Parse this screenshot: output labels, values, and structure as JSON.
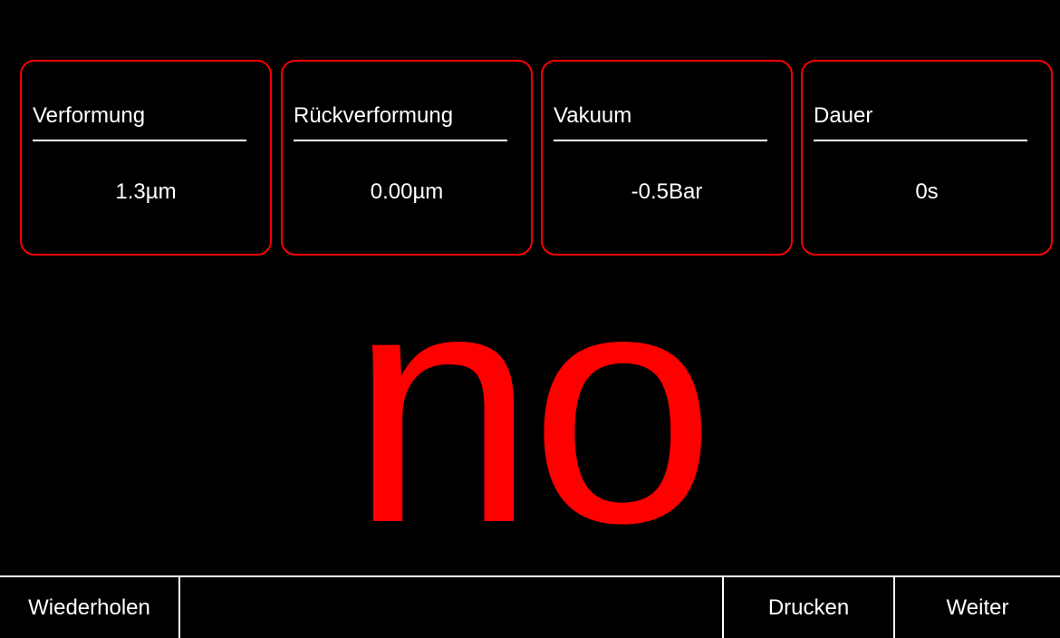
{
  "colors": {
    "background": "#000000",
    "accent": "#ff0000",
    "text": "#ffffff"
  },
  "cards": [
    {
      "title": "Verformung",
      "value": "1.3µm"
    },
    {
      "title": "Rückverformung",
      "value": "0.00µm"
    },
    {
      "title": "Vakuum",
      "value": "-0.5Bar"
    },
    {
      "title": "Dauer",
      "value": "0s"
    }
  ],
  "result": {
    "text": "no"
  },
  "bottom_bar": {
    "repeat_label": "Wiederholen",
    "print_label": "Drucken",
    "next_label": "Weiter"
  }
}
